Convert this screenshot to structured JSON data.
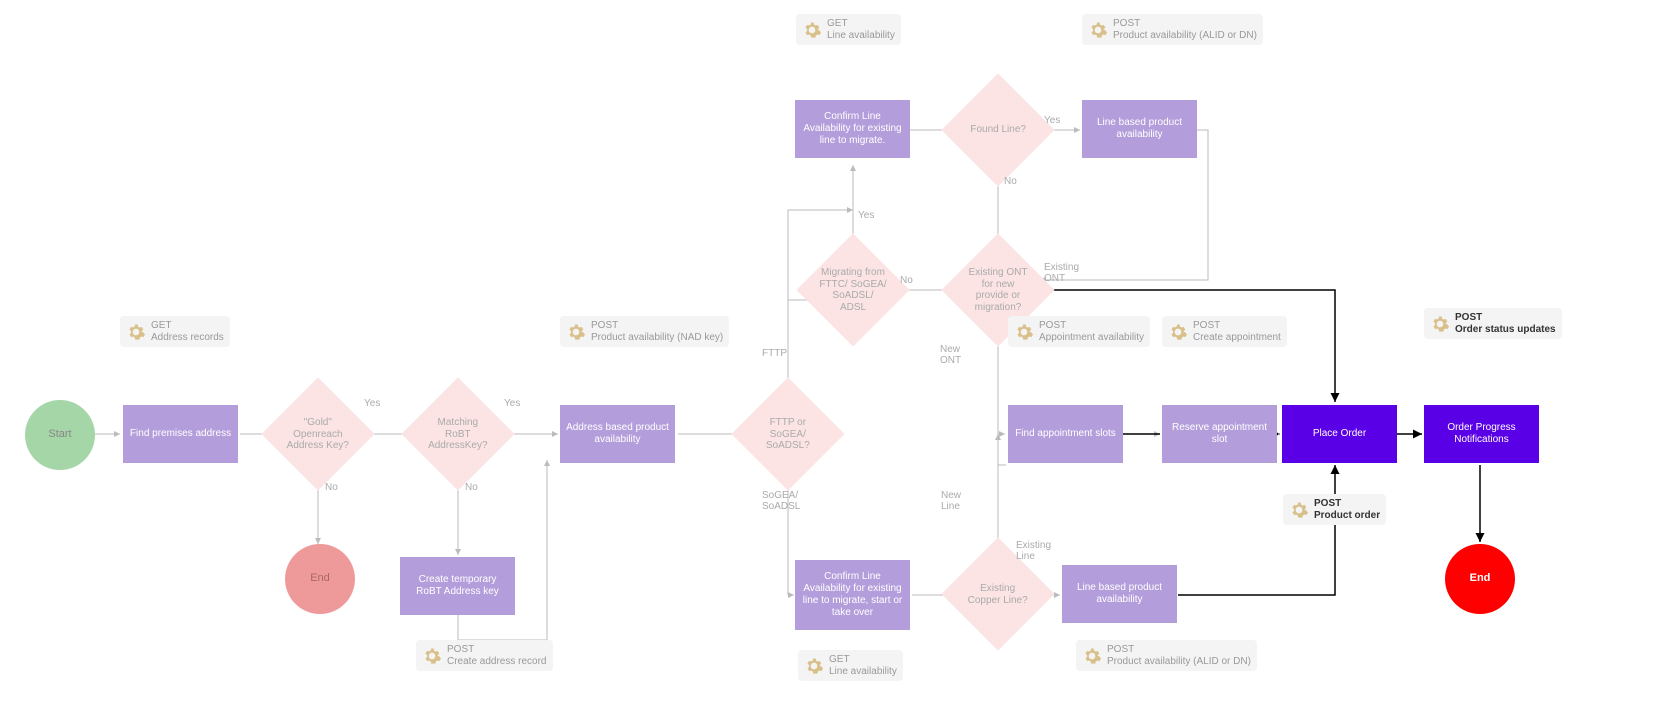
{
  "start": "Start",
  "end_faded": "End",
  "end_bold": "End",
  "rects": {
    "find_premises": "Find premises address",
    "create_temp": "Create temporary RoBT Address key",
    "addr_based": "Address based product availability",
    "confirm_top": "Confirm Line Availability for existing line to migrate.",
    "line_prod_top": "Line based product availability",
    "confirm_bot": "Confirm Line Availability for existing line to migrate, start or take over",
    "line_prod_bot": "Line based product availability",
    "find_appt": "Find appointment slots",
    "reserve_appt": "Reserve appointment slot",
    "place_order": "Place Order",
    "order_prog": "Order Progress Notifications"
  },
  "diamonds": {
    "gold": "\"Gold\" Openreach Address Key?",
    "robt": "Matching RoBT AddressKey?",
    "fttp_or": "FTTP or SoGEA/ SoADSL?",
    "migrating": "Migrating from FTTC/ SoGEA/ SoADSL/ ADSL",
    "found_line": "Found Line?",
    "existing_ont": "Existing ONT for new provide or migration?",
    "copper": "Existing Copper Line?"
  },
  "apis": {
    "get_addr": "GET\nAddress records",
    "post_create_addr": "POST\nCreate address record",
    "post_prod_nad": "POST\nProduct availability (NAD key)",
    "get_line_top": "GET\nLine availability",
    "post_prod_alid_top": "POST\nProduct availability (ALID or DN)",
    "get_line_bot": "GET\nLine availability",
    "post_prod_alid_bot": "POST\nProduct availability (ALID or DN)",
    "post_appt": "POST\nAppointment availability",
    "post_create_appt": "POST\nCreate appointment",
    "post_prod_order": "POST\nProduct order",
    "post_order_status": "POST\nOrder status updates"
  },
  "labels": {
    "yes": "Yes",
    "no": "No",
    "fttp": "FTTP",
    "sogea": "SoGEA/\nSoADSL",
    "new_ont": "New\nONT",
    "existing_ont": "Existing\nONT",
    "new_line": "New\nLine",
    "existing_line": "Existing\nLine"
  }
}
